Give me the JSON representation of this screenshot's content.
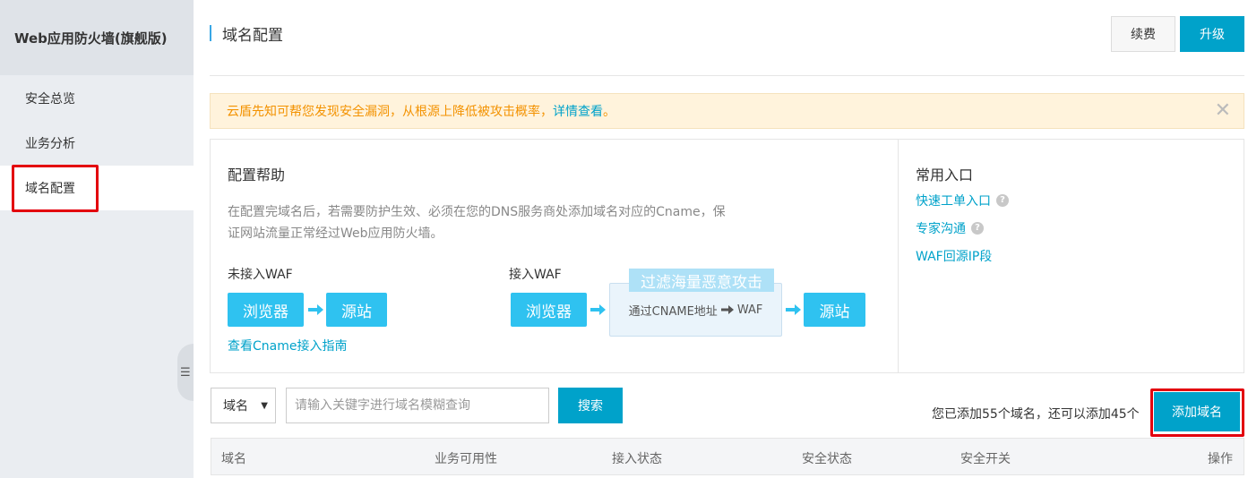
{
  "sidebar": {
    "title": "Web应用防火墙(旗舰版)",
    "items": [
      {
        "label": "安全总览"
      },
      {
        "label": "业务分析"
      },
      {
        "label": "域名配置",
        "active": true
      }
    ]
  },
  "header": {
    "title": "域名配置",
    "renew_label": "续费",
    "upgrade_label": "升级"
  },
  "notice": {
    "text": "云盾先知可帮您发现安全漏洞，从根源上降低被攻击概率，",
    "link": "详情查看",
    "suffix": "。",
    "close": "✕"
  },
  "help": {
    "title": "配置帮助",
    "desc_line1": "在配置完域名后，若需要防护生效、必须在您的DNS服务商处添加域名对应的Cname，保",
    "desc_line2": "证网站流量正常经过Web应用防火墙。",
    "without_waf": {
      "label": "未接入WAF",
      "browser": "浏览器",
      "origin": "源站"
    },
    "with_waf": {
      "label": "接入WAF",
      "browser": "浏览器",
      "filter": "过滤海量恶意攻击",
      "cname_prefix": "通过CNAME地址",
      "cname_suffix": "WAF",
      "origin": "源站"
    },
    "guide_link": "查看Cname接入指南"
  },
  "entries": {
    "title": "常用入口",
    "links": [
      {
        "label": "快速工单入口",
        "help": true
      },
      {
        "label": "专家沟通",
        "help": true
      },
      {
        "label": "WAF回源IP段",
        "help": false
      }
    ]
  },
  "search": {
    "select_value": "域名",
    "placeholder": "请输入关键字进行域名模糊查询",
    "button": "搜索",
    "count_text": "您已添加55个域名，还可以添加45个",
    "add_button": "添加域名"
  },
  "table": {
    "columns": [
      "域名",
      "业务可用性",
      "接入状态",
      "安全状态",
      "安全开关",
      "操作"
    ]
  },
  "colors": {
    "accent": "#00a2ca",
    "highlight_box": "#e3000e",
    "flow_box": "#2fc2f0",
    "notice_bg": "#fff3dc",
    "notice_text": "#f39200"
  }
}
